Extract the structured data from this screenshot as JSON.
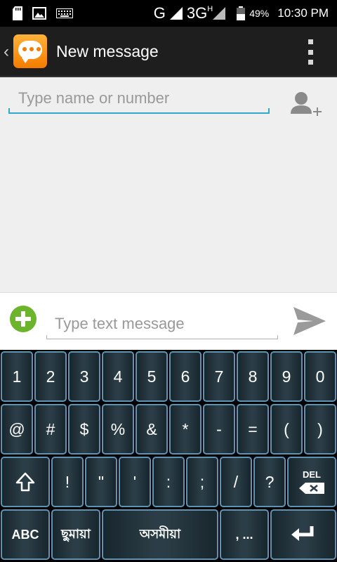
{
  "status_bar": {
    "network_g": "G",
    "network_3g": "3G",
    "network_3g_sup": "H",
    "battery_percent": "49%",
    "time": "10:30 PM",
    "left_icons": [
      "sd-card-icon",
      "image-icon",
      "keyboard-icon"
    ]
  },
  "action_bar": {
    "title": "New message",
    "back_glyph": "‹",
    "app_icon": "messaging-bubble-icon",
    "menu_icon": "overflow-menu-icon"
  },
  "recipient": {
    "placeholder": "Type name or number",
    "value": "",
    "add_contact_icon": "add-contact-icon"
  },
  "compose": {
    "placeholder": "Type text message",
    "value": "",
    "attach_icon": "add-attachment-icon",
    "send_icon": "send-icon"
  },
  "colors": {
    "accent": "#33a6cc",
    "attach_green": "#6cb42c",
    "action_bar": "#1e1e1e",
    "content_bg": "#efefef",
    "key_border": "#5f93b3"
  },
  "keyboard": {
    "row1": [
      "1",
      "2",
      "3",
      "4",
      "5",
      "6",
      "7",
      "8",
      "9",
      "0"
    ],
    "row2": [
      "@",
      "#",
      "$",
      "%",
      "&",
      "*",
      "-",
      "=",
      "(",
      ")"
    ],
    "row3": [
      "!",
      "\"",
      "'",
      ":",
      ";",
      "/",
      "?"
    ],
    "shift_icon": "shift-arrow-icon",
    "del_label": "DEL",
    "abc_label": "ABC",
    "lang_bangla": "ছুমায়া",
    "lang_assamese": "অসমীয়া",
    "punct_label": ", ...",
    "enter_icon": "enter-arrow-icon"
  }
}
